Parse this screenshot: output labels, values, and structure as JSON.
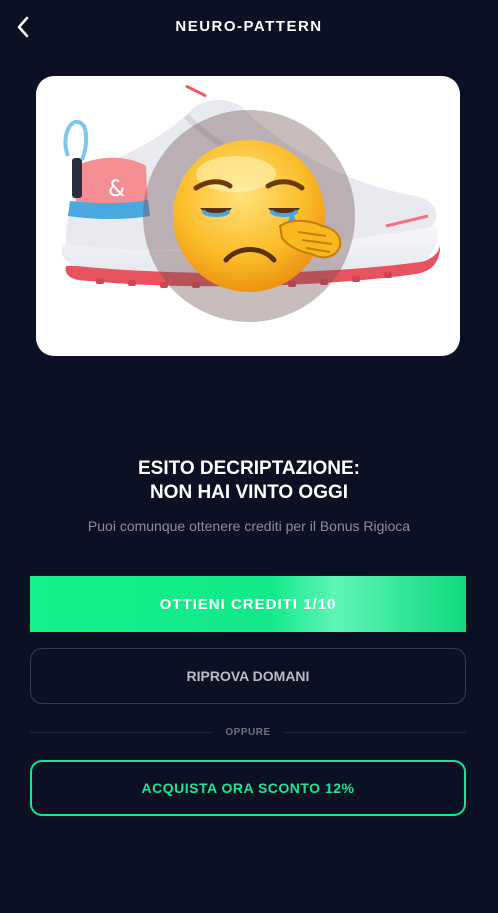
{
  "header": {
    "title": "NEURO-PATTERN",
    "back_icon": "chevron-left-icon"
  },
  "product": {
    "image": "sneaker",
    "overlay_icon": "crying-face-icon",
    "brand_mark": "&"
  },
  "result": {
    "line1": "ESITO DECRIPTAZIONE:",
    "line2": "NON HAI VINTO OGGI",
    "subtitle": "Puoi comunque ottenere crediti per il Bonus Rigioca"
  },
  "actions": {
    "primary_label": "OTTIENI CREDITI 1/10",
    "secondary_label": "RIPROVA DOMANI",
    "divider_label": "OPPURE",
    "buy_label": "ACQUISTA ORA SCONTO 12%"
  },
  "colors": {
    "background": "#0b1022",
    "accent_green": "#14f08c",
    "outline_green": "#1de395",
    "card": "#ffffff"
  }
}
